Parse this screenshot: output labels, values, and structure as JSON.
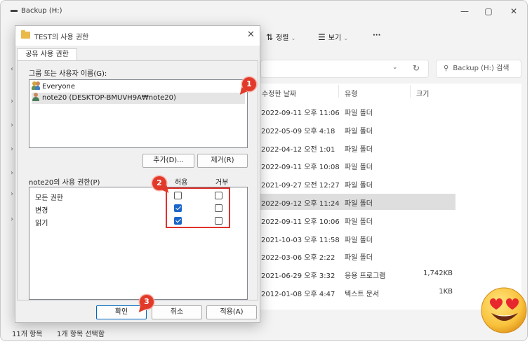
{
  "explorer": {
    "title": "Backup (H:)",
    "window_buttons": [
      "—",
      "▢",
      "✕"
    ],
    "toolbar": {
      "sort_label": "정렬",
      "view_label": "보기",
      "more_label": "···"
    },
    "search_placeholder": "Backup (H:) 검색",
    "columns": {
      "modified": "수정한 날짜",
      "type": "유형",
      "size": "크기"
    },
    "rows": [
      {
        "date": "2022-09-11 오후 11:06",
        "type": "파일 폴더",
        "size": ""
      },
      {
        "date": "2022-05-09 오후 4:18",
        "type": "파일 폴더",
        "size": ""
      },
      {
        "date": "2022-04-12 오전 1:01",
        "type": "파일 폴더",
        "size": ""
      },
      {
        "date": "2022-09-11 오후 10:08",
        "type": "파일 폴더",
        "size": ""
      },
      {
        "date": "2021-09-27 오전 12:27",
        "type": "파일 폴더",
        "size": ""
      },
      {
        "date": "2022-09-12 오후 11:24",
        "type": "파일 폴더",
        "size": "",
        "selected": true
      },
      {
        "date": "2022-09-11 오후 10:06",
        "type": "파일 폴더",
        "size": ""
      },
      {
        "date": "2021-10-03 오후 11:58",
        "type": "파일 폴더",
        "size": ""
      },
      {
        "date": "2022-03-06 오후 2:22",
        "type": "파일 폴더",
        "size": ""
      },
      {
        "date": "2021-06-29 오후 3:32",
        "type": "응용 프로그램",
        "size": "1,742KB"
      },
      {
        "date": "2012-01-08 오후 4:47",
        "type": "텍스트 문서",
        "size": "1KB"
      }
    ],
    "status": {
      "items": "11개 항목",
      "selected": "1개 항목 선택함"
    }
  },
  "dialog": {
    "title": "TEST의 사용 권한",
    "tab": "공유 사용 권한",
    "group_label": "그룹 또는 사용자 이름(G):",
    "users": [
      {
        "name": "Everyone",
        "icon": "group-users-icon"
      },
      {
        "name": "note20 (DESKTOP-BMUVH9A₩note20)",
        "icon": "user-icon",
        "selected": true
      }
    ],
    "add_button": "추가(D)...",
    "remove_button": "제거(R)",
    "perm_label": "note20의 사용 권한(P)",
    "allow_header": "허용",
    "deny_header": "거부",
    "permissions": [
      {
        "name": "모든 권한",
        "allow": false,
        "deny": false
      },
      {
        "name": "변경",
        "allow": true,
        "deny": false
      },
      {
        "name": "읽기",
        "allow": true,
        "deny": false
      }
    ],
    "ok_button": "확인",
    "cancel_button": "취소",
    "apply_button": "적용(A)"
  },
  "annotations": {
    "badge1": "1",
    "badge2": "2",
    "badge3": "3",
    "color": "#e23a2a"
  }
}
